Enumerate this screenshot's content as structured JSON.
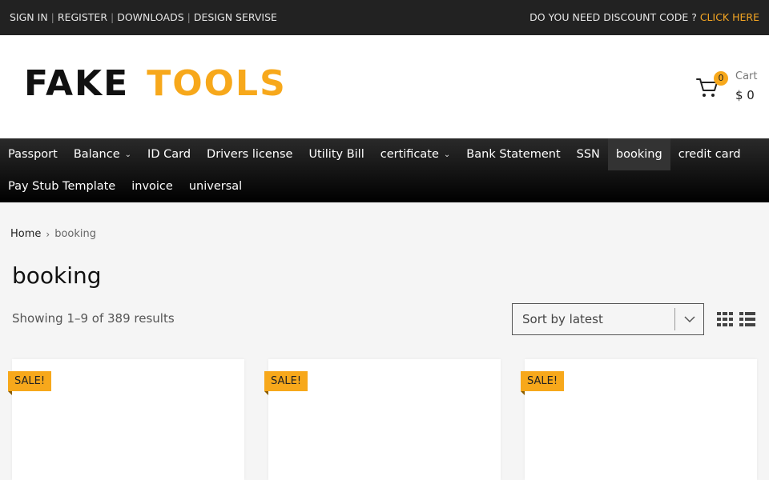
{
  "topbar": {
    "links": [
      "SIGN IN",
      "REGISTER",
      "DOWNLOADS",
      "DESIGN SERVISE"
    ],
    "separator": "|",
    "promo_text": "DO YOU NEED DISCOUNT CODE ? ",
    "promo_link": "CLICK HERE"
  },
  "header": {
    "logo_word1": "FAKE",
    "logo_word2": "TOOLS",
    "cart_count": "0",
    "cart_label": "Cart",
    "cart_total": "$ 0"
  },
  "nav": {
    "row1": [
      {
        "label": "Passport",
        "chevron": ""
      },
      {
        "label": "Balance",
        "chevron": "⌄"
      },
      {
        "label": "ID Card",
        "chevron": ""
      },
      {
        "label": "Drivers license",
        "chevron": ""
      },
      {
        "label": "Utility Bill",
        "chevron": ""
      },
      {
        "label": "certificate",
        "chevron": "⌄"
      },
      {
        "label": "Bank Statement",
        "chevron": ""
      },
      {
        "label": "SSN",
        "chevron": ""
      },
      {
        "label": "booking",
        "chevron": ""
      },
      {
        "label": "credit card",
        "chevron": ""
      }
    ],
    "row2": [
      {
        "label": "Pay Stub Template"
      },
      {
        "label": "invoice"
      },
      {
        "label": "universal"
      }
    ],
    "active": "booking"
  },
  "breadcrumb": {
    "home": "Home",
    "separator": "›",
    "current": "booking"
  },
  "page": {
    "title": "booking",
    "results_text": "Showing 1–9 of 389 results",
    "sort_value": "Sort by latest"
  },
  "products": [
    {
      "badge": "SALE!"
    },
    {
      "badge": "SALE!"
    },
    {
      "badge": "SALE!"
    }
  ],
  "colors": {
    "accent": "#f7a81b",
    "topbar": "#222222",
    "nav_active": "#333333"
  },
  "icons": {
    "cart": "cart-icon",
    "sort_arrow": "chevron-down-icon",
    "grid_view": "grid-view-icon",
    "list_view": "list-view-icon"
  }
}
